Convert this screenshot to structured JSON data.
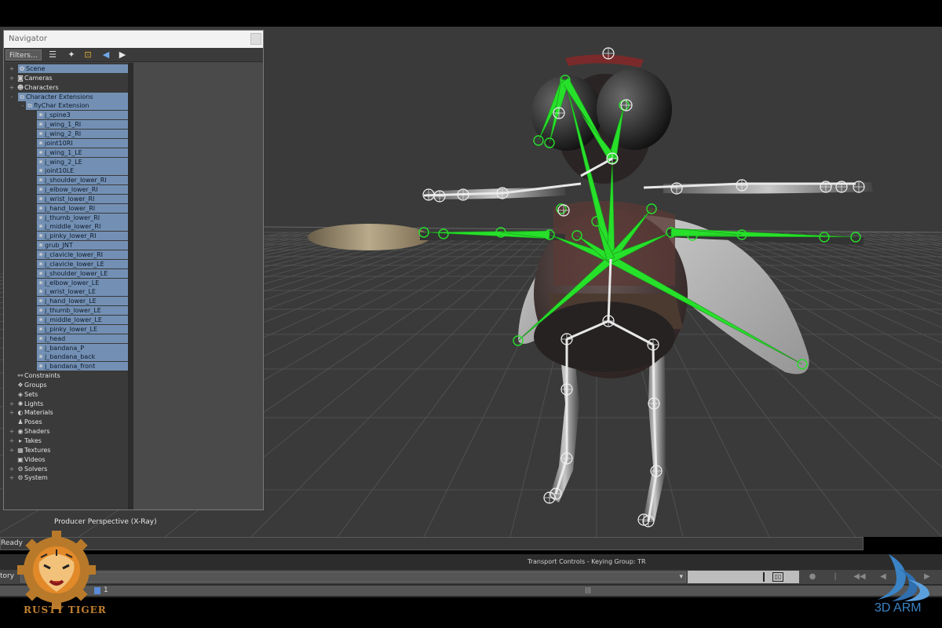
{
  "navigator": {
    "title": "Navigator",
    "filters_label": "Filters...",
    "tree": [
      {
        "label": "Scene",
        "level": 0,
        "expander": "+",
        "icon": "scene-icon",
        "selected": true
      },
      {
        "label": "Cameras",
        "level": 0,
        "expander": "+",
        "icon": "camera-icon",
        "selected": false
      },
      {
        "label": "Characters",
        "level": 0,
        "expander": "+",
        "icon": "character-icon",
        "selected": false
      },
      {
        "label": "Character Extensions",
        "level": 0,
        "expander": "-",
        "icon": "character-extension-icon",
        "selected": true
      },
      {
        "label": "flyChar Extension",
        "level": 1,
        "expander": "-",
        "icon": "extension-icon",
        "selected": true
      },
      {
        "label": "j_spine3",
        "level": 2,
        "expander": "",
        "icon": "joint-icon",
        "selected": true
      },
      {
        "label": "j_wing_1_RI",
        "level": 2,
        "expander": "",
        "icon": "joint-icon",
        "selected": true
      },
      {
        "label": "j_wing_2_RI",
        "level": 2,
        "expander": "",
        "icon": "joint-icon",
        "selected": true
      },
      {
        "label": "joint10RI",
        "level": 2,
        "expander": "",
        "icon": "joint-icon",
        "selected": true
      },
      {
        "label": "j_wing_1_LE",
        "level": 2,
        "expander": "",
        "icon": "joint-icon",
        "selected": true
      },
      {
        "label": "j_wing_2_LE",
        "level": 2,
        "expander": "",
        "icon": "joint-icon",
        "selected": true
      },
      {
        "label": "joint10LE",
        "level": 2,
        "expander": "",
        "icon": "joint-icon",
        "selected": true
      },
      {
        "label": "j_shoulder_lower_RI",
        "level": 2,
        "expander": "",
        "icon": "joint-icon",
        "selected": true
      },
      {
        "label": "j_elbow_lower_RI",
        "level": 2,
        "expander": "",
        "icon": "joint-icon",
        "selected": true
      },
      {
        "label": "j_wrist_lower_RI",
        "level": 2,
        "expander": "",
        "icon": "joint-icon",
        "selected": true
      },
      {
        "label": "j_hand_lower_RI",
        "level": 2,
        "expander": "",
        "icon": "joint-icon",
        "selected": true
      },
      {
        "label": "j_thumb_lower_RI",
        "level": 2,
        "expander": "",
        "icon": "joint-icon",
        "selected": true
      },
      {
        "label": "j_middle_lower_RI",
        "level": 2,
        "expander": "",
        "icon": "joint-icon",
        "selected": true
      },
      {
        "label": "j_pinky_lower_RI",
        "level": 2,
        "expander": "",
        "icon": "joint-icon",
        "selected": true
      },
      {
        "label": "grub_JNT",
        "level": 2,
        "expander": "",
        "icon": "joint-icon",
        "selected": true
      },
      {
        "label": "j_clavicle_lower_RI",
        "level": 2,
        "expander": "",
        "icon": "joint-icon",
        "selected": true
      },
      {
        "label": "j_clavicle_lower_LE",
        "level": 2,
        "expander": "",
        "icon": "joint-icon",
        "selected": true
      },
      {
        "label": "j_shoulder_lower_LE",
        "level": 2,
        "expander": "",
        "icon": "joint-icon",
        "selected": true
      },
      {
        "label": "j_elbow_lower_LE",
        "level": 2,
        "expander": "",
        "icon": "joint-icon",
        "selected": true
      },
      {
        "label": "j_wrist_lower_LE",
        "level": 2,
        "expander": "",
        "icon": "joint-icon",
        "selected": true
      },
      {
        "label": "j_hand_lower_LE",
        "level": 2,
        "expander": "",
        "icon": "joint-icon",
        "selected": true
      },
      {
        "label": "j_thumb_lower_LE",
        "level": 2,
        "expander": "",
        "icon": "joint-icon",
        "selected": true
      },
      {
        "label": "j_middle_lower_LE",
        "level": 2,
        "expander": "",
        "icon": "joint-icon",
        "selected": true
      },
      {
        "label": "j_pinky_lower_LE",
        "level": 2,
        "expander": "",
        "icon": "joint-icon",
        "selected": true
      },
      {
        "label": "j_head",
        "level": 2,
        "expander": "",
        "icon": "joint-icon",
        "selected": true
      },
      {
        "label": "j_bandana_P",
        "level": 2,
        "expander": "",
        "icon": "joint-icon",
        "selected": true
      },
      {
        "label": "j_bandana_back",
        "level": 2,
        "expander": "",
        "icon": "joint-icon",
        "selected": true
      },
      {
        "label": "j_bandana_front",
        "level": 2,
        "expander": "",
        "icon": "joint-icon",
        "selected": true
      },
      {
        "label": "Constraints",
        "level": 0,
        "expander": "",
        "icon": "constraint-icon",
        "selected": false
      },
      {
        "label": "Groups",
        "level": 0,
        "expander": "",
        "icon": "group-icon",
        "selected": false
      },
      {
        "label": "Sets",
        "level": 0,
        "expander": "",
        "icon": "set-icon",
        "selected": false
      },
      {
        "label": "Lights",
        "level": 0,
        "expander": "+",
        "icon": "light-icon",
        "selected": false
      },
      {
        "label": "Materials",
        "level": 0,
        "expander": "+",
        "icon": "material-icon",
        "selected": false
      },
      {
        "label": "Poses",
        "level": 0,
        "expander": "",
        "icon": "pose-icon",
        "selected": false
      },
      {
        "label": "Shaders",
        "level": 0,
        "expander": "+",
        "icon": "shader-icon",
        "selected": false
      },
      {
        "label": "Takes",
        "level": 0,
        "expander": "+",
        "icon": "take-icon",
        "selected": false
      },
      {
        "label": "Textures",
        "level": 0,
        "expander": "+",
        "icon": "texture-icon",
        "selected": false
      },
      {
        "label": "Videos",
        "level": 0,
        "expander": "",
        "icon": "video-icon",
        "selected": false
      },
      {
        "label": "Solvers",
        "level": 0,
        "expander": "+",
        "icon": "solver-icon",
        "selected": false
      },
      {
        "label": "System",
        "level": 0,
        "expander": "+",
        "icon": "system-icon",
        "selected": false
      }
    ]
  },
  "viewport": {
    "label": "Producer Perspective (X-Ray)"
  },
  "status": {
    "text": "Ready"
  },
  "transport": {
    "title": "Transport Controls  -  Keying Group: TR",
    "story_label": "tory",
    "frame_start": "1",
    "frame_tick": "|||"
  },
  "logos": {
    "rusty_tiger": "RUSTY TIGER",
    "three_d_arm": "3D ARM"
  },
  "colors": {
    "selection": "#7390b4",
    "skeleton_green": "#27e02a",
    "viewport_bg": "#3a3a3a"
  }
}
